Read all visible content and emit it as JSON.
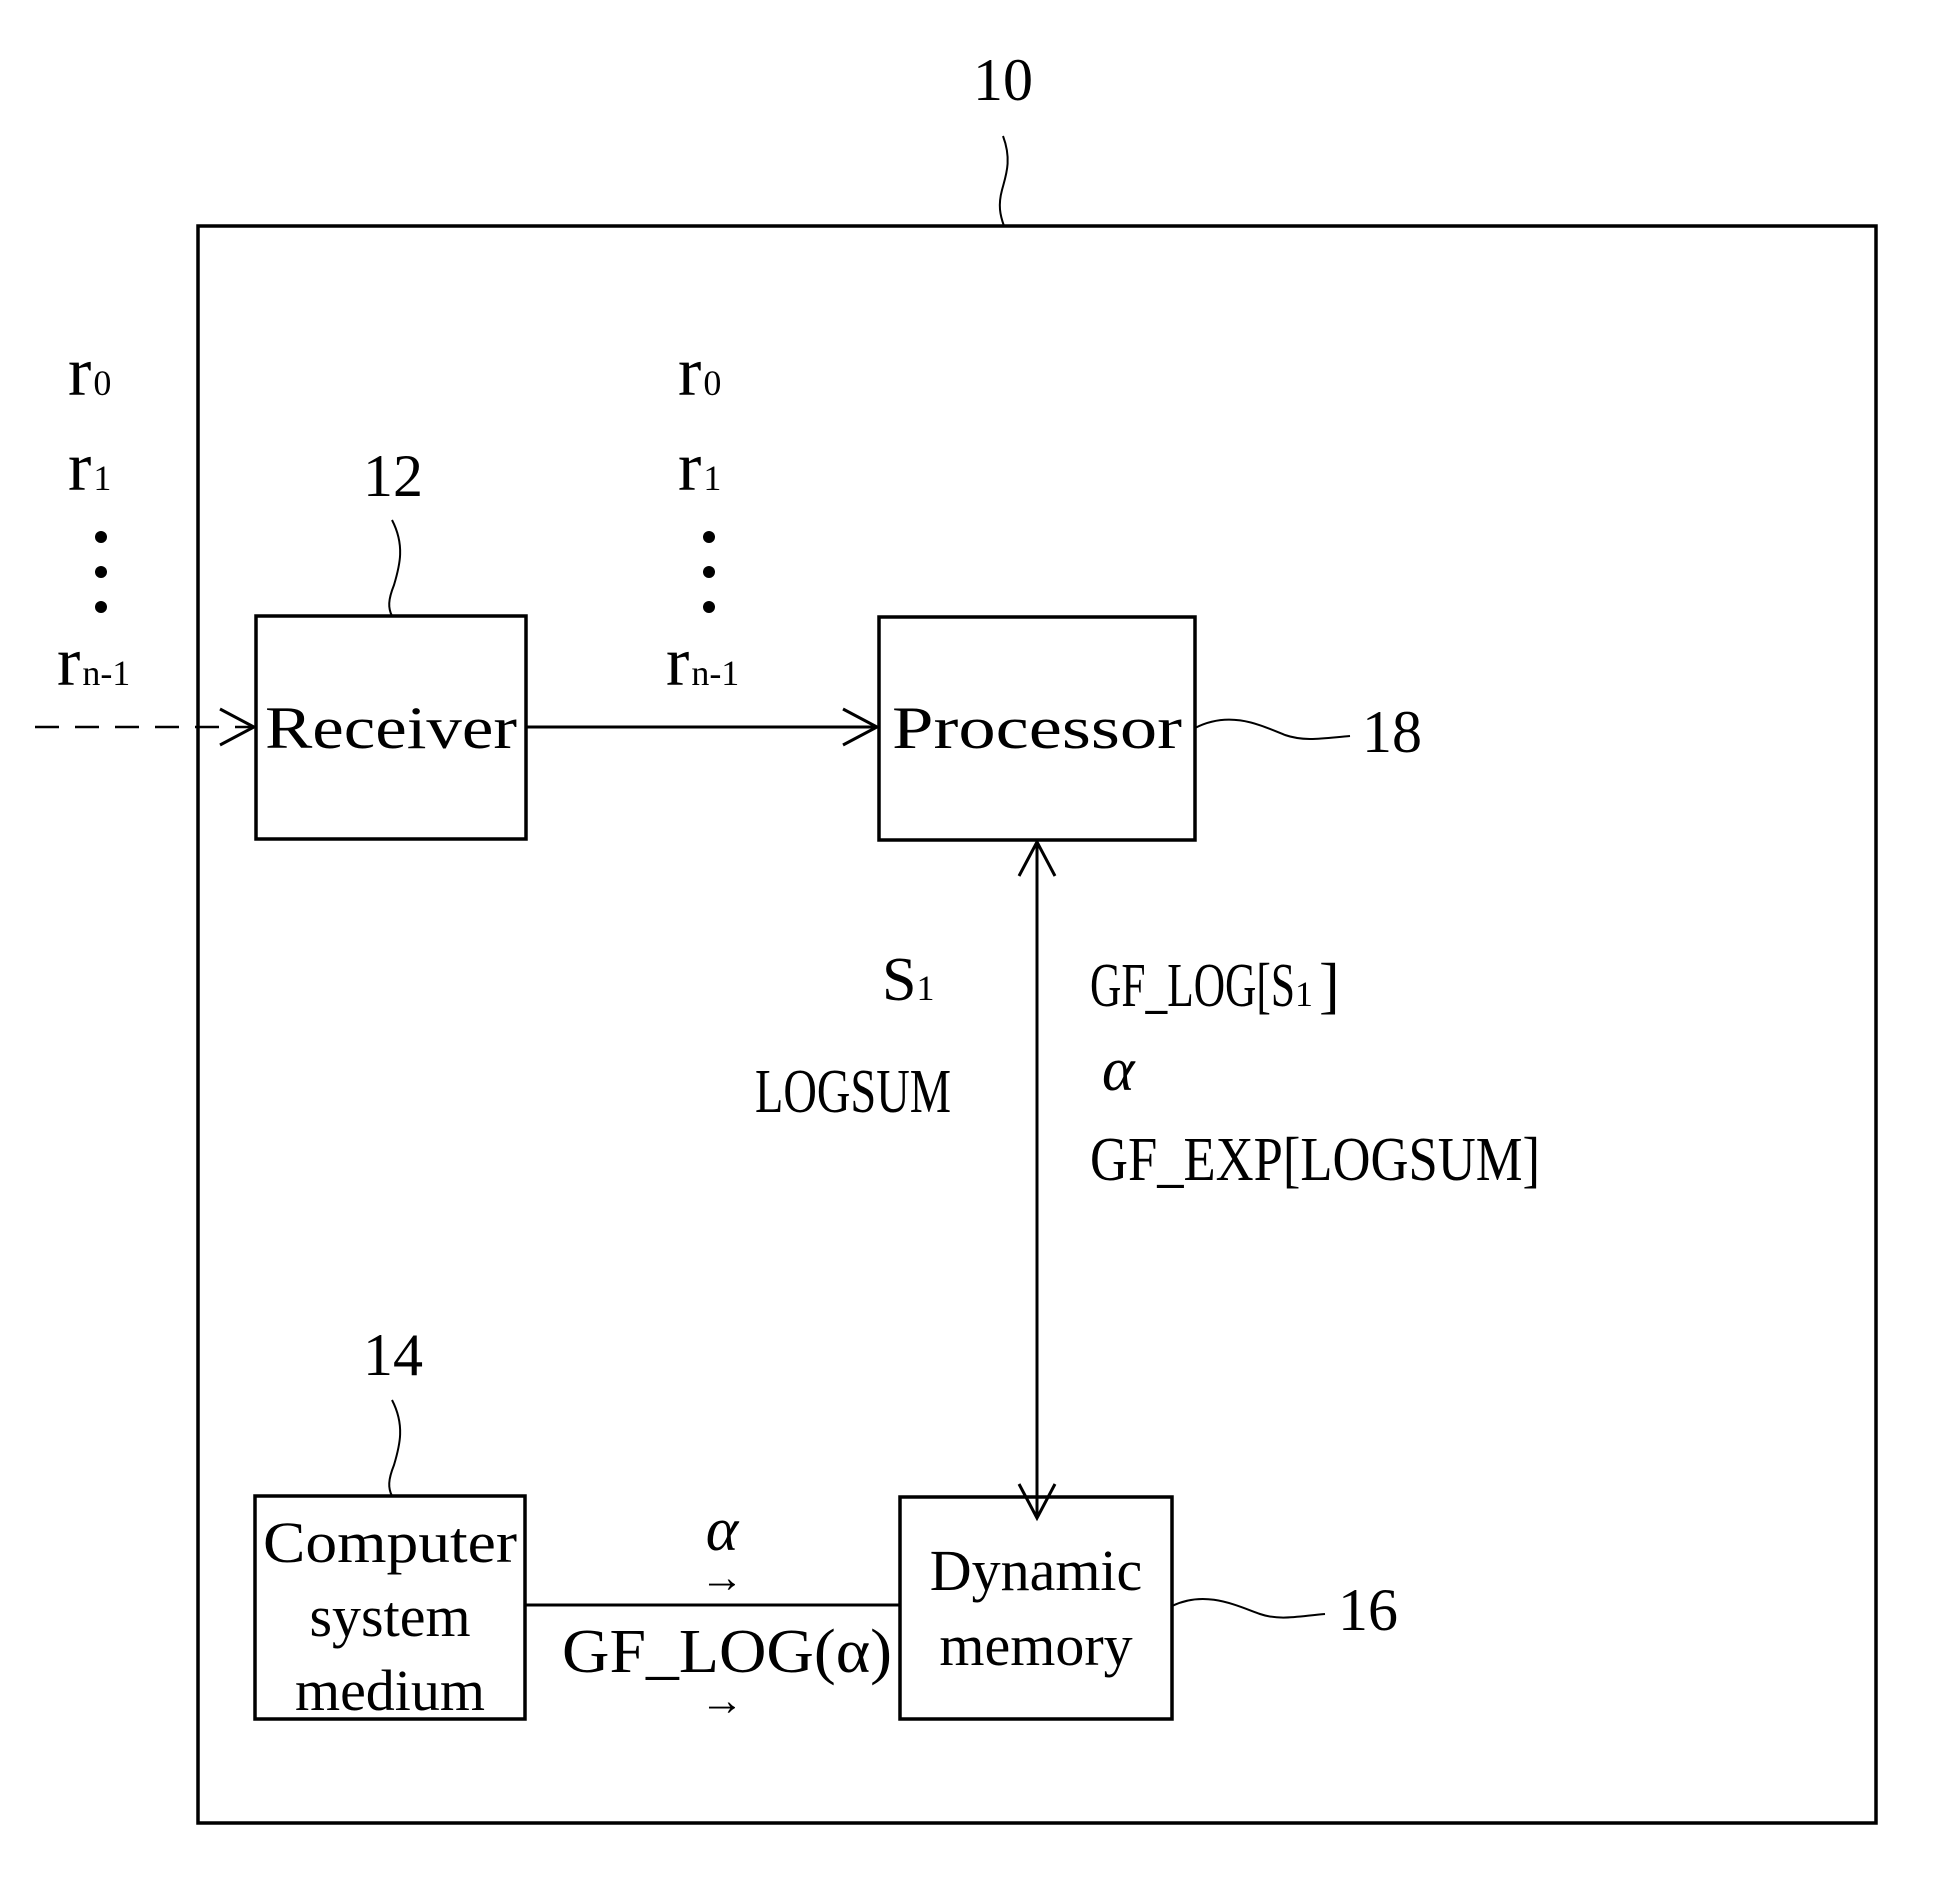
{
  "figure": {
    "system_ref": "10",
    "blocks": {
      "receiver": {
        "label": "Receiver",
        "ref": "12"
      },
      "processor": {
        "label": "Processor",
        "ref": "18"
      },
      "medium": {
        "lines": [
          "Computer",
          "system",
          "medium"
        ],
        "ref": "14"
      },
      "memory": {
        "lines": [
          "Dynamic",
          "memory"
        ],
        "ref": "16"
      }
    },
    "input_symbols": {
      "r0": "r",
      "r0_sub": "0",
      "r1": "r",
      "r1_sub": "1",
      "rn": "r",
      "rn_sub": "n-1"
    },
    "bus_left": {
      "s1": "S",
      "s1_sub": "1",
      "logsum": "LOGSUM"
    },
    "bus_right": {
      "line1_a": "GF_LOG[S",
      "line1_sub": "1",
      "line1_b": "]",
      "line2": "α",
      "line3": "GF_EXP[LOGSUM]"
    },
    "medium_link": {
      "top": "α",
      "bottom": "GF_LOG(α)",
      "arrow": "→"
    }
  }
}
